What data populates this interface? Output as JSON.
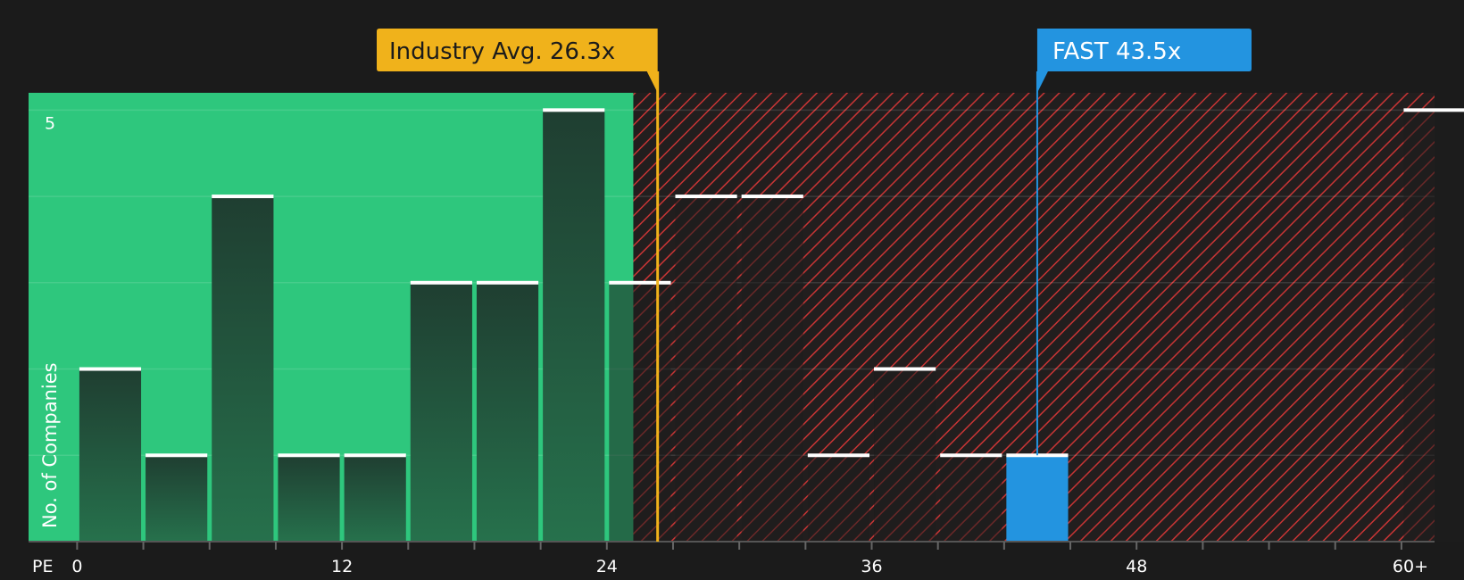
{
  "chart_data": {
    "type": "bar",
    "title": "",
    "xlabel": "PE",
    "ylabel": "No. of Companies",
    "x_ticks": [
      "0",
      "12",
      "24",
      "36",
      "48",
      "60+"
    ],
    "x_tick_values": [
      0,
      12,
      24,
      36,
      48,
      60
    ],
    "y_ticks": [
      "5"
    ],
    "y_tick_values": [
      5
    ],
    "ylim": [
      0,
      5.2
    ],
    "xlim": [
      -2.2,
      61.5
    ],
    "grid": true,
    "bin_width": 3,
    "bins": [
      {
        "start": 0,
        "count": 2
      },
      {
        "start": 3,
        "count": 1
      },
      {
        "start": 6,
        "count": 4
      },
      {
        "start": 9,
        "count": 1
      },
      {
        "start": 12,
        "count": 1
      },
      {
        "start": 15,
        "count": 3
      },
      {
        "start": 18,
        "count": 3
      },
      {
        "start": 21,
        "count": 5
      },
      {
        "start": 24,
        "count": 3
      },
      {
        "start": 27,
        "count": 4
      },
      {
        "start": 30,
        "count": 4
      },
      {
        "start": 33,
        "count": 1
      },
      {
        "start": 36,
        "count": 2
      },
      {
        "start": 39,
        "count": 1
      },
      {
        "start": 42,
        "count": 1,
        "highlight": true
      },
      {
        "start": 60,
        "count": 5
      }
    ],
    "fair_zone_max": 25.2,
    "industry_avg": {
      "label": "Industry Avg. 26.3x",
      "value": 26.3,
      "color": "#f0b21b"
    },
    "company": {
      "label": "FAST 43.5x",
      "value": 43.5,
      "color": "#2394e0"
    },
    "colors": {
      "background": "#1b1b1b",
      "fair_zone": "#2ec77d",
      "overvalued_hatch": "#d23a3a",
      "bar_fill": "#234a38",
      "bar_cap": "#ffffff",
      "highlight_bar": "#2394e0"
    }
  }
}
